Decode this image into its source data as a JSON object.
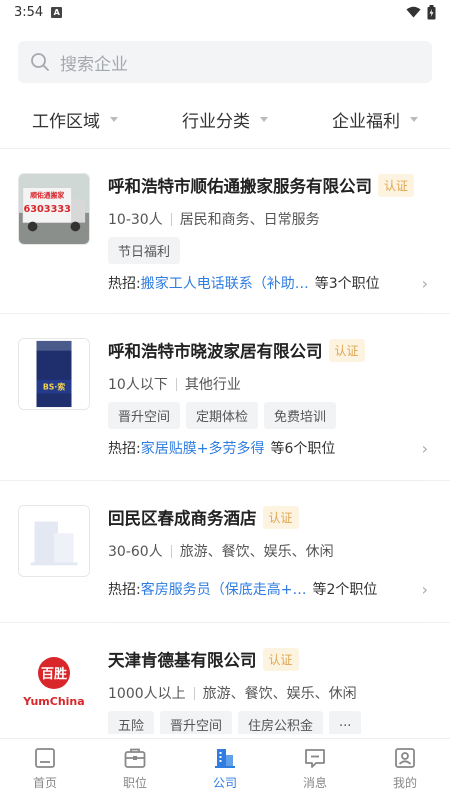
{
  "status": {
    "time": "3:54",
    "a_label": "A"
  },
  "search": {
    "placeholder": "搜索企业"
  },
  "filters": [
    "工作区域",
    "行业分类",
    "企业福利"
  ],
  "companies": [
    {
      "name": "呼和浩特市顺佑通搬家服务有限公司",
      "badge": "认证",
      "size": "10-30人",
      "industry": "居民和商务、日常服务",
      "tags": [
        "节日福利"
      ],
      "hot_label": "热招:",
      "hot_job": "搬家工人电话联系（补助…",
      "hot_count": "等3个职位",
      "logo_text": "顺佑通搬家",
      "logo_number": "6303333"
    },
    {
      "name": "呼和浩特市晓波家居有限公司",
      "badge": "认证",
      "size": "10人以下",
      "industry": "其他行业",
      "tags": [
        "晋升空间",
        "定期体检",
        "免费培训"
      ],
      "hot_label": "热招:",
      "hot_job": "家居贴膜+多劳多得",
      "hot_count": "等6个职位",
      "logo_text": "BS·索"
    },
    {
      "name": "回民区春成商务酒店",
      "badge": "认证",
      "size": "30-60人",
      "industry": "旅游、餐饮、娱乐、休闲",
      "tags": [],
      "hot_label": "热招:",
      "hot_job": "客房服务员（保底走高+…",
      "hot_count": "等2个职位"
    },
    {
      "name": "天津肯德基有限公司",
      "badge": "认证",
      "size": "1000人以上",
      "industry": "旅游、餐饮、娱乐、休闲",
      "tags": [
        "五险",
        "晋升空间",
        "住房公积金",
        "..."
      ],
      "logo_brand": "YumChina",
      "logo_char": "百胜"
    }
  ],
  "tabs": [
    {
      "label": "首页",
      "icon": "home-icon"
    },
    {
      "label": "职位",
      "icon": "briefcase-icon"
    },
    {
      "label": "公司",
      "icon": "building-icon",
      "active": true
    },
    {
      "label": "消息",
      "icon": "message-icon"
    },
    {
      "label": "我的",
      "icon": "profile-icon"
    }
  ],
  "colors": {
    "accent": "#2f7de1",
    "badge_bg": "#fdf3e1",
    "badge_text": "#e0a650",
    "yum_red": "#d8262b"
  }
}
